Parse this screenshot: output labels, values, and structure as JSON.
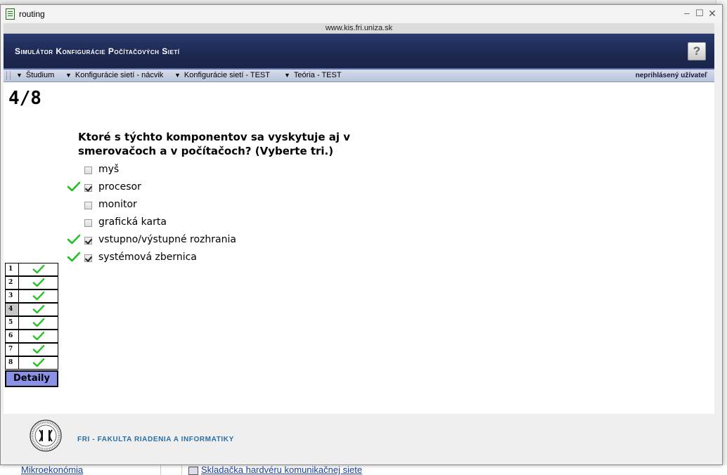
{
  "window": {
    "title": "routing",
    "url": "www.kis.fri.uniza.sk",
    "minimize_glyph": "–",
    "maximize_glyph": "☐",
    "close_glyph": "✕"
  },
  "banner": {
    "title": "Simulátor Konfigurácie Počítačových Sietí",
    "help_label": "?"
  },
  "menu": {
    "items": [
      {
        "label": "Študium"
      },
      {
        "label": "Konfigurácie sietí - nácvik"
      },
      {
        "label": "Konfigurácie sietí - TEST"
      },
      {
        "label": "Teória - TEST"
      }
    ],
    "caret": "▼",
    "user_status": "neprihlásený užívateľ"
  },
  "quiz": {
    "counter": "4/8",
    "question": "Ktoré s týchto komponentov sa vyskytuje aj v smerovačoch a v počítačoch? (Vyberte tri.)",
    "answers": [
      {
        "label": "myš",
        "checked": false,
        "correct_mark": false
      },
      {
        "label": "procesor",
        "checked": true,
        "correct_mark": true
      },
      {
        "label": "monitor",
        "checked": false,
        "correct_mark": false
      },
      {
        "label": "grafická karta",
        "checked": false,
        "correct_mark": false
      },
      {
        "label": "vstupno/výstupné rozhrania",
        "checked": true,
        "correct_mark": true
      },
      {
        "label": "systémová zbernica",
        "checked": true,
        "correct_mark": true
      }
    ],
    "navigator": [
      {
        "num": "1",
        "status": "correct"
      },
      {
        "num": "2",
        "status": "correct"
      },
      {
        "num": "3",
        "status": "correct"
      },
      {
        "num": "4",
        "status": "correct",
        "current": true
      },
      {
        "num": "5",
        "status": "correct"
      },
      {
        "num": "6",
        "status": "correct"
      },
      {
        "num": "7",
        "status": "correct"
      },
      {
        "num": "8",
        "status": "correct"
      }
    ],
    "details_button": "Detaily"
  },
  "footer": {
    "text": "FRI - FAKULTA RIADENIA A INFORMATIKY"
  },
  "background": {
    "link_1": "Mikroekonómia",
    "link_2": "Skladačka hardvéru komunikačnej siete"
  },
  "colors": {
    "check_green": "#1fc21f",
    "banner_navy": "#1c2850",
    "details_button": "#8a92e8",
    "footer_text": "#2a6fa5"
  }
}
